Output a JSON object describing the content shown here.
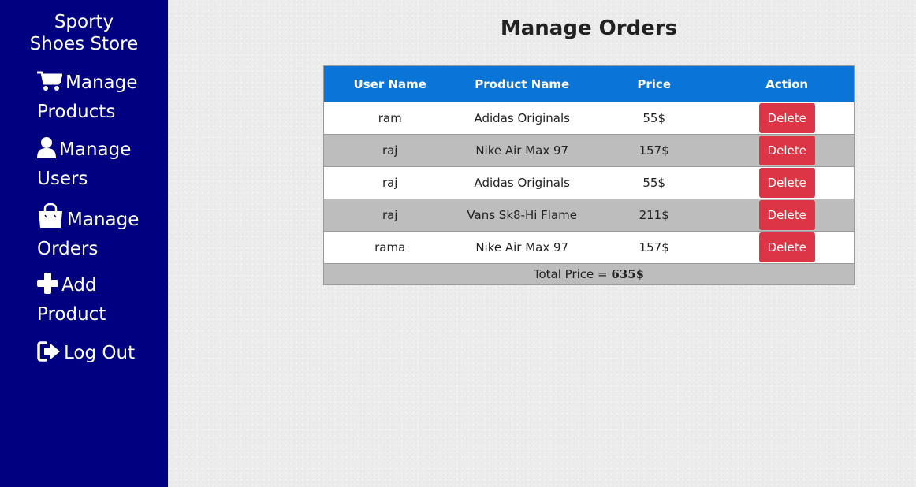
{
  "sidebar": {
    "brand_line1": "Sporty",
    "brand_line2": "Shoes Store",
    "items": [
      {
        "icon": "cart-icon",
        "line1": "Manage",
        "line2": "Products"
      },
      {
        "icon": "user-icon",
        "line1": "Manage",
        "line2": "Users"
      },
      {
        "icon": "shopping-bag-icon",
        "line1": "Manage",
        "line2": "Orders"
      },
      {
        "icon": "plus-icon",
        "line1": "Add",
        "line2": "Product"
      },
      {
        "icon": "sign-out-icon",
        "line1": "Log Out"
      }
    ]
  },
  "main": {
    "title": "Manage Orders",
    "table": {
      "headers": [
        "User Name",
        "Product Name",
        "Price",
        "Action"
      ],
      "rows": [
        {
          "user": "ram",
          "product": "Adidas Originals",
          "price": "55$",
          "action": "Delete"
        },
        {
          "user": "raj",
          "product": "Nike Air Max 97",
          "price": "157$",
          "action": "Delete"
        },
        {
          "user": "raj",
          "product": "Adidas Originals",
          "price": "55$",
          "action": "Delete"
        },
        {
          "user": "raj",
          "product": "Vans Sk8-Hi Flame",
          "price": "211$",
          "action": "Delete"
        },
        {
          "user": "rama",
          "product": "Nike Air Max 97",
          "price": "157$",
          "action": "Delete"
        }
      ],
      "total_label": "Total Price = ",
      "total_value": "635$"
    }
  },
  "colors": {
    "sidebar_bg": "#000080",
    "header_bg": "#0b74d7",
    "delete_button": "#dc3545",
    "alt_row": "#bdbdbd"
  }
}
